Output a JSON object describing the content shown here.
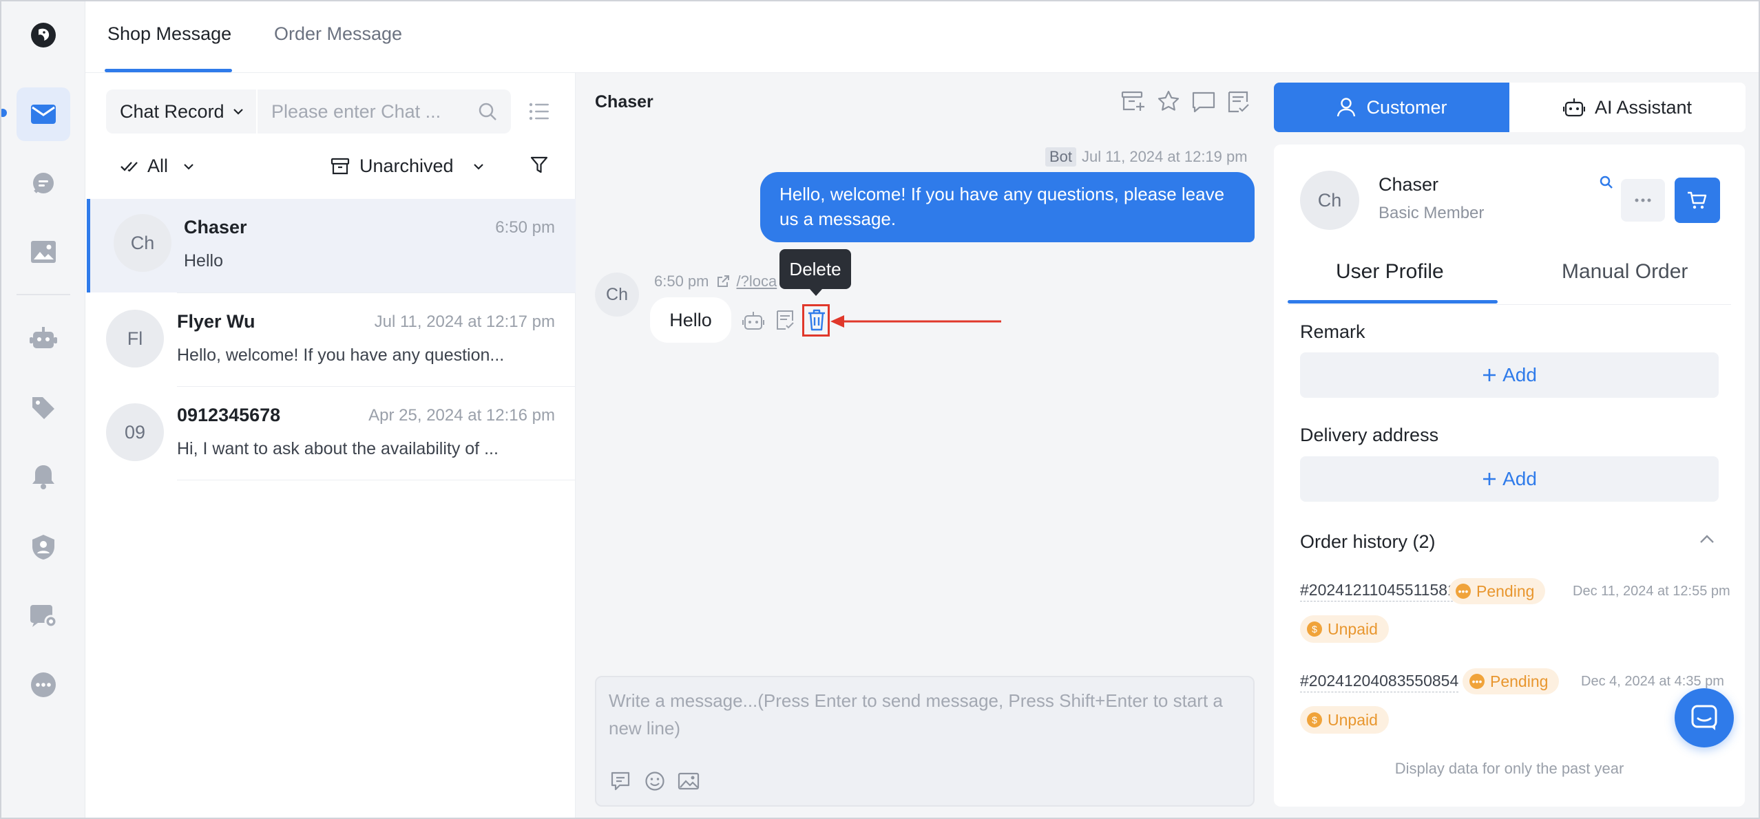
{
  "app": {
    "logo_icon": "parrot-logo-icon",
    "accent_color": "#2f7bea"
  },
  "rail": {
    "items": [
      {
        "name": "messages",
        "icon": "mail-icon",
        "active": true
      },
      {
        "name": "comments",
        "icon": "chat-bubble-icon"
      },
      {
        "name": "media",
        "icon": "image-icon"
      },
      {
        "name": "bot",
        "icon": "robot-icon"
      },
      {
        "name": "tags",
        "icon": "tag-icon"
      },
      {
        "name": "notifications",
        "icon": "bell-icon"
      },
      {
        "name": "contacts",
        "icon": "user-shield-icon"
      },
      {
        "name": "chat-settings",
        "icon": "chat-settings-icon"
      },
      {
        "name": "more",
        "icon": "more-icon"
      }
    ]
  },
  "top_tabs": {
    "shop": "Shop Message",
    "order": "Order Message"
  },
  "list": {
    "search": {
      "scope": "Chat Record",
      "placeholder": "Please enter Chat ..."
    },
    "filter_read": "All",
    "filter_archive": "Unarchived",
    "conversations": [
      {
        "initials": "Ch",
        "name": "Chaser",
        "time": "6:50 pm",
        "preview": "Hello"
      },
      {
        "initials": "Fl",
        "name": "Flyer Wu",
        "time": "Jul 11, 2024 at 12:17 pm",
        "preview": "Hello, welcome! If you have any question..."
      },
      {
        "initials": "09",
        "name": "0912345678",
        "time": "Apr 25, 2024 at 12:16 pm",
        "preview": "Hi, I want to ask about the availability of ..."
      }
    ]
  },
  "chat": {
    "title": "Chaser",
    "bot_tag": "Bot",
    "bot_time": "Jul 11, 2024 at 12:19 pm",
    "outgoing_text": "Hello, welcome! If you have any questions, please leave us a message.",
    "incoming_avatar": "Ch",
    "incoming_time": "6:50 pm",
    "incoming_link": "/?loca",
    "incoming_text": "Hello",
    "tooltip": "Delete",
    "composer_placeholder": "Write a message...(Press Enter to send message, Press Shift+Enter to start a new line)",
    "highlight_color": "#e0382b"
  },
  "right": {
    "segments": {
      "customer": "Customer",
      "ai": "AI Assistant"
    },
    "customer": {
      "initials": "Ch",
      "name": "Chaser",
      "level": "Basic Member"
    },
    "subtabs": {
      "profile": "User Profile",
      "order": "Manual Order"
    },
    "remark": {
      "title": "Remark",
      "add": "Add"
    },
    "delivery": {
      "title": "Delivery address",
      "add": "Add"
    },
    "order_history": {
      "title": "Order history (2)",
      "orders": [
        {
          "id": "#20241211045511581",
          "status": "Pending",
          "date": "Dec 11, 2024 at 12:55 pm",
          "payment": "Unpaid"
        },
        {
          "id": "#20241204083550854",
          "status": "Pending",
          "date": "Dec 4, 2024 at 4:35 pm",
          "payment": "Unpaid"
        }
      ]
    },
    "footer_note": "Display data for only the past year"
  }
}
